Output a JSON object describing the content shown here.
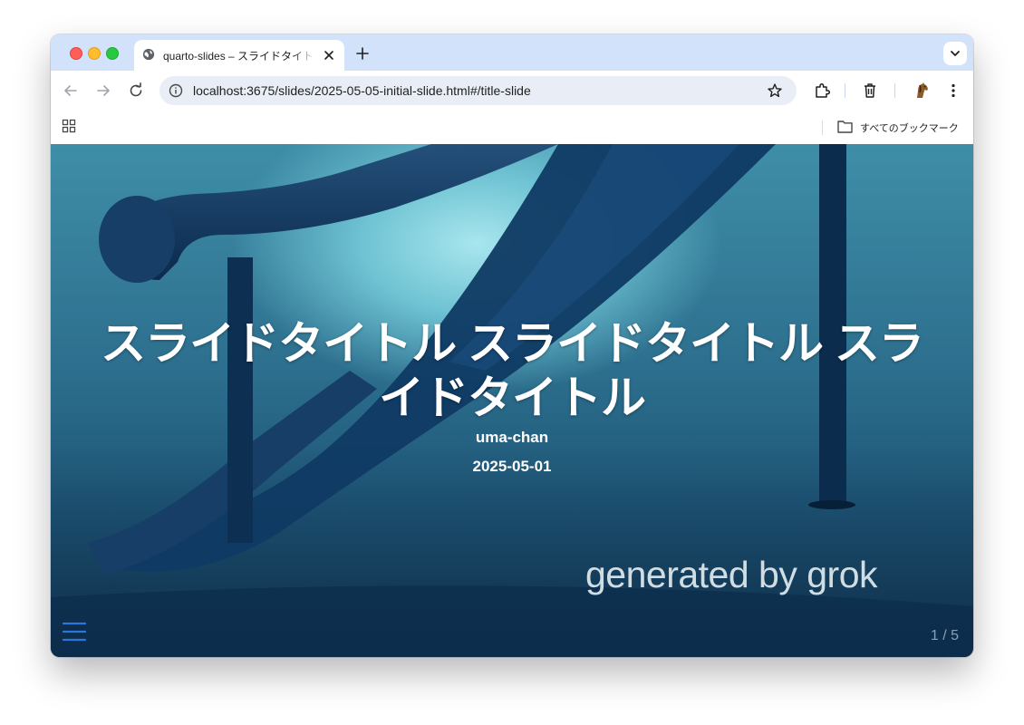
{
  "browser": {
    "tab": {
      "title": "quarto-slides – スライドタイトル スライドタイトル スライドタイトル"
    },
    "address_bar": {
      "url": "localhost:3675/slides/2025-05-05-initial-slide.html#/title-slide"
    },
    "bookmarks_bar": {
      "all_bookmarks_label": "すべてのブックマーク"
    },
    "accent_color": "#d3e2fb"
  },
  "slide": {
    "title": "スライドタイトル スライドタイトル スライドタイトル",
    "author": "uma-chan",
    "date": "2025-05-01",
    "watermark": "generated by grok",
    "slide_number": "1 / 5",
    "menu_color": "#2a76dd"
  }
}
